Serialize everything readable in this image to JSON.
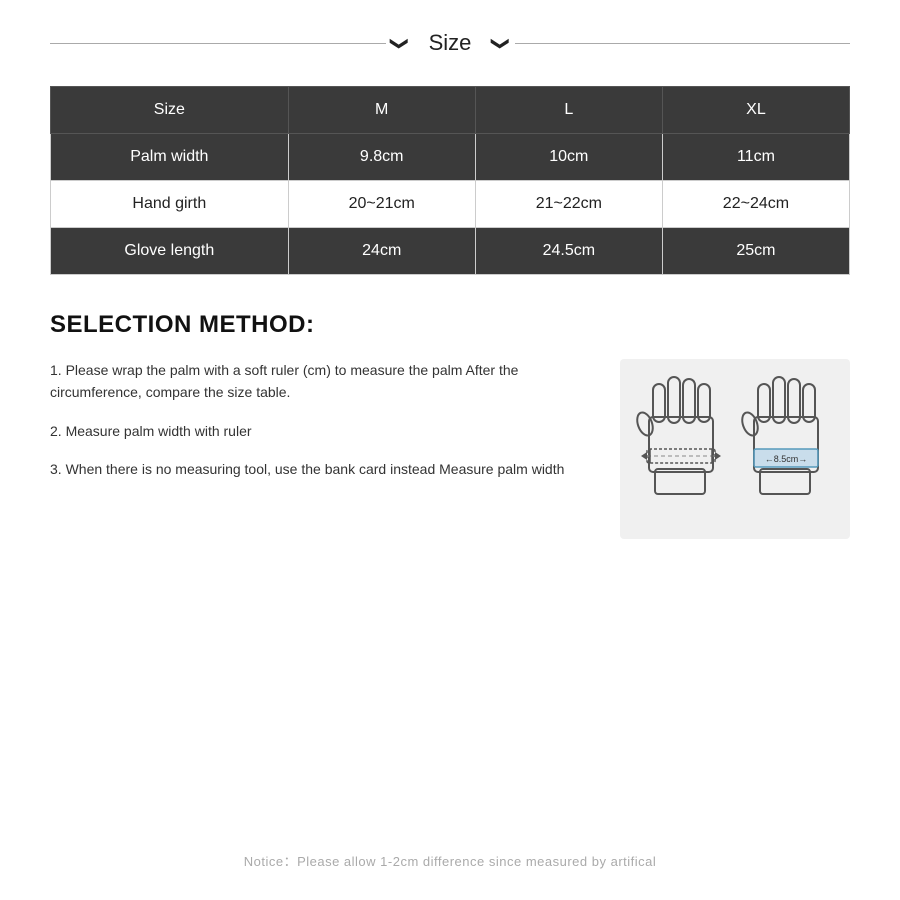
{
  "header": {
    "title": "Size",
    "line_left": true,
    "chevron_left": "❯",
    "chevron_right": "❯"
  },
  "table": {
    "columns": [
      "Size",
      "M",
      "L",
      "XL"
    ],
    "rows": [
      {
        "label": "Palm width",
        "m": "9.8cm",
        "l": "10cm",
        "xl": "11cm"
      },
      {
        "label": "Hand girth",
        "m": "20~21cm",
        "l": "21~22cm",
        "xl": "22~24cm"
      },
      {
        "label": "Glove length",
        "m": "24cm",
        "l": "24.5cm",
        "xl": "25cm"
      }
    ]
  },
  "selection": {
    "title": "SELECTION METHOD:",
    "steps": [
      "1. Please wrap the palm with a soft ruler (cm) to measure the palm After the circumference, compare the size table.",
      "2. Measure palm width with ruler",
      "3. When there is no measuring tool, use the bank card instead Measure palm width"
    ]
  },
  "notice": "Notice：Please allow 1-2cm difference since measured by artifical"
}
